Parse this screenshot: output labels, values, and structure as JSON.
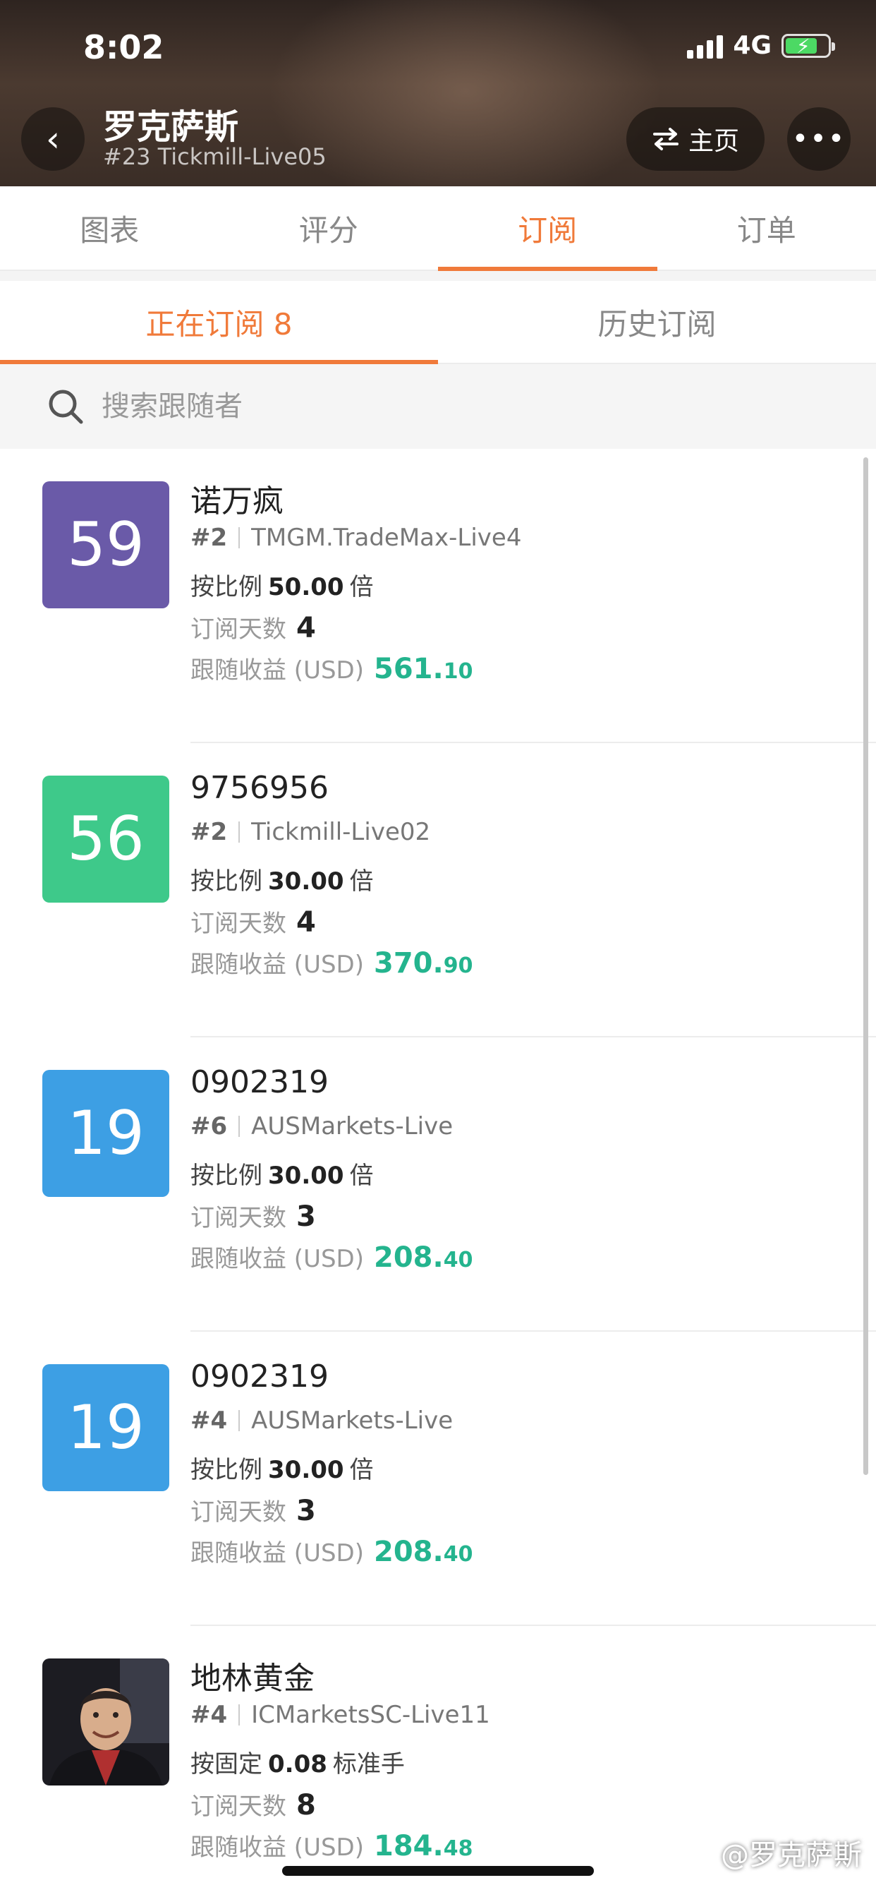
{
  "status": {
    "time": "8:02",
    "network": "4G"
  },
  "header": {
    "title": "罗克萨斯",
    "subtitle": "#23 Tickmill-Live05",
    "home_label": "主页"
  },
  "main_tabs": [
    {
      "label": "图表",
      "active": false
    },
    {
      "label": "评分",
      "active": false
    },
    {
      "label": "订阅",
      "active": true
    },
    {
      "label": "订单",
      "active": false
    }
  ],
  "sub_tabs": [
    {
      "label": "正在订阅 8",
      "active": true
    },
    {
      "label": "历史订阅",
      "active": false
    }
  ],
  "search": {
    "placeholder": "搜索跟随者"
  },
  "labels": {
    "days": "订阅天数",
    "profit": "跟随收益 (USD)"
  },
  "subscribers": [
    {
      "score": "59",
      "badge_color": "#6a5aa8",
      "name": "诺万疯",
      "rank": "#2",
      "account": "TMGM.TradeMax-Live4",
      "ratio_prefix": "按比例",
      "ratio_value": "50.00",
      "ratio_suffix": "倍",
      "days": "4",
      "profit_int": "561.",
      "profit_dec": "10"
    },
    {
      "score": "56",
      "badge_color": "#3ec98a",
      "name": "9756956",
      "rank": "#2",
      "account": "Tickmill-Live02",
      "ratio_prefix": "按比例",
      "ratio_value": "30.00",
      "ratio_suffix": "倍",
      "days": "4",
      "profit_int": "370.",
      "profit_dec": "90"
    },
    {
      "score": "19",
      "badge_color": "#3d9fe4",
      "name": "0902319",
      "rank": "#6",
      "account": "AUSMarkets-Live",
      "ratio_prefix": "按比例",
      "ratio_value": "30.00",
      "ratio_suffix": "倍",
      "days": "3",
      "profit_int": "208.",
      "profit_dec": "40"
    },
    {
      "score": "19",
      "badge_color": "#3d9fe4",
      "name": "0902319",
      "rank": "#4",
      "account": "AUSMarkets-Live",
      "ratio_prefix": "按比例",
      "ratio_value": "30.00",
      "ratio_suffix": "倍",
      "days": "3",
      "profit_int": "208.",
      "profit_dec": "40"
    },
    {
      "score": "",
      "badge_color": "",
      "avatar": true,
      "name": "地林黄金",
      "rank": "#4",
      "account": "ICMarketsSC-Live11",
      "ratio_prefix": "按固定",
      "ratio_value": "0.08",
      "ratio_suffix": "标准手",
      "days": "8",
      "profit_int": "184.",
      "profit_dec": "48"
    }
  ],
  "watermark": "@罗克萨斯"
}
